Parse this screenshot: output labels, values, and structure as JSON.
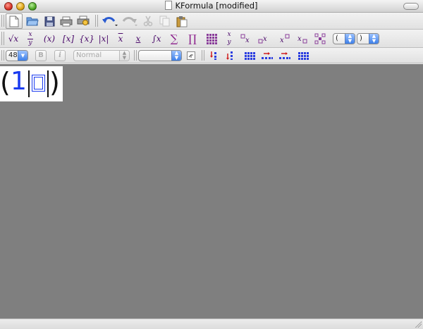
{
  "window": {
    "title": "KFormula [modified]"
  },
  "toolbar_main": {
    "buttons": [
      {
        "name": "new-document",
        "icon": "new-document-icon",
        "active": true
      },
      {
        "name": "open",
        "icon": "folder-open-icon"
      },
      {
        "name": "save",
        "icon": "floppy-disk-icon"
      },
      {
        "name": "print",
        "icon": "printer-icon"
      },
      {
        "name": "print-preview",
        "icon": "print-preview-icon"
      },
      {
        "name": "undo",
        "icon": "undo-arrow-icon"
      },
      {
        "name": "redo",
        "icon": "redo-arrow-icon",
        "disabled": true
      },
      {
        "name": "cut",
        "icon": "scissors-icon",
        "disabled": true
      },
      {
        "name": "copy",
        "icon": "copy-icon",
        "disabled": true
      },
      {
        "name": "paste",
        "icon": "paste-clipboard-icon"
      }
    ]
  },
  "toolbar_math": {
    "root_label": "√x",
    "frac_num": "x",
    "frac_den": "y",
    "paren_label": "(x)",
    "bracket_label": "[x]",
    "brace_label": "{x}",
    "abs_label": "|x|",
    "overline_label": "x",
    "underline_label": "x",
    "integral_label": "∫x",
    "sum_label": "∑",
    "product_label": "∏",
    "stack_num": "x",
    "stack_den": "y",
    "left_bracket_value": "(",
    "right_bracket_value": ")"
  },
  "toolbar_format": {
    "font_size": "48",
    "bold_label": "B",
    "italic_label": "i",
    "style_value": "Normal",
    "symbol_value": ""
  },
  "formula": {
    "left_paren": "(",
    "number": "1",
    "right_paren": ")"
  },
  "colors": {
    "canvas_bg": "#7f7f7f",
    "formula_blue": "#1a3bf0",
    "math_purple": "#4a0a6a"
  }
}
